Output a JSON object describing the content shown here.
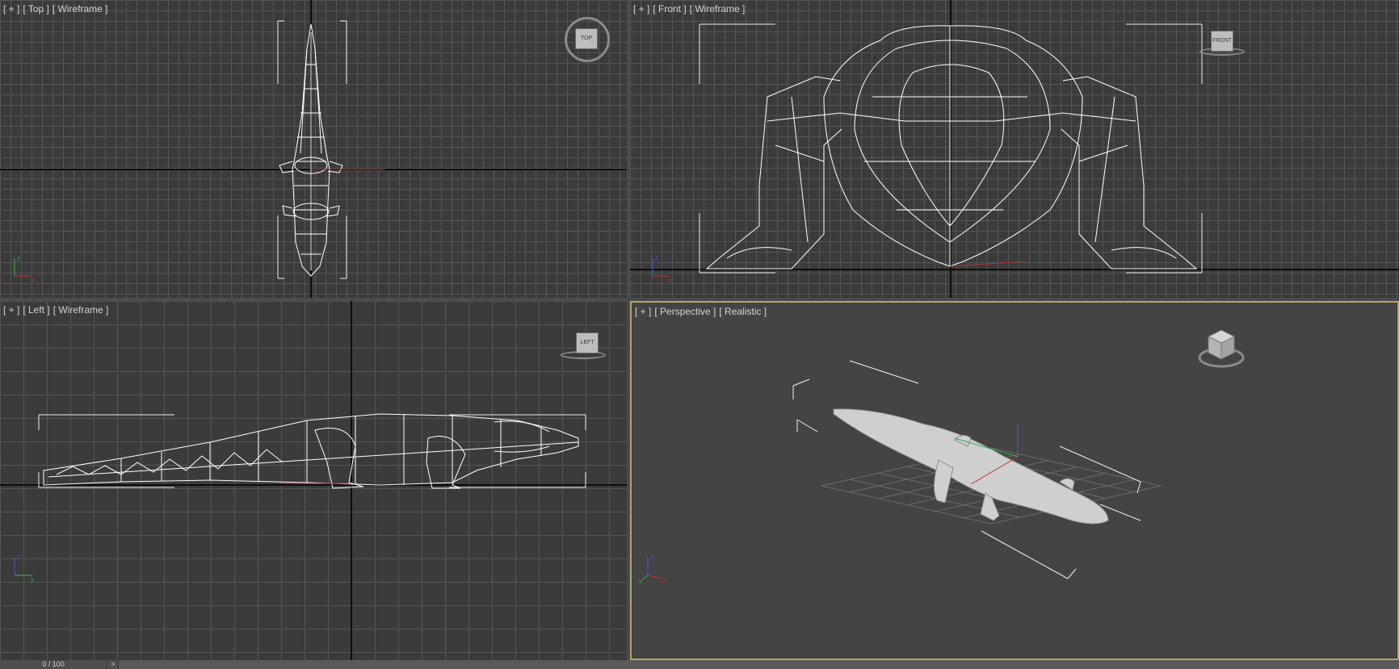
{
  "viewports": {
    "top": {
      "bracket": "[ + ]",
      "view": "[ Top ]",
      "shading": "[ Wireframe ]",
      "viewcube_face": "TOP"
    },
    "front": {
      "bracket": "[ + ]",
      "view": "[ Front ]",
      "shading": "[ Wireframe ]",
      "viewcube_face": "FRONT"
    },
    "left": {
      "bracket": "[ + ]",
      "view": "[ Left ]",
      "shading": "[ Wireframe ]",
      "viewcube_face": "LEFT"
    },
    "persp": {
      "bracket": "[ + ]",
      "view": "[ Perspective ]",
      "shading": "[ Realistic ]",
      "viewcube_face": ""
    }
  },
  "gizmo_labels": {
    "x": "x",
    "y": "y",
    "z": "z"
  },
  "timeline": {
    "frame": "0 / 100",
    "next": ">"
  },
  "colors": {
    "viewport_bg": "#3b3b3b",
    "grid": "#555555",
    "wire": "#ffffff",
    "active_border": "#b7a264",
    "axis_x": "#c03030",
    "axis_y": "#2fb34a",
    "axis_z": "#3a5cd0"
  },
  "icons": [
    "viewcube-icon",
    "steering-ring-icon",
    "axis-tripod-icon"
  ]
}
